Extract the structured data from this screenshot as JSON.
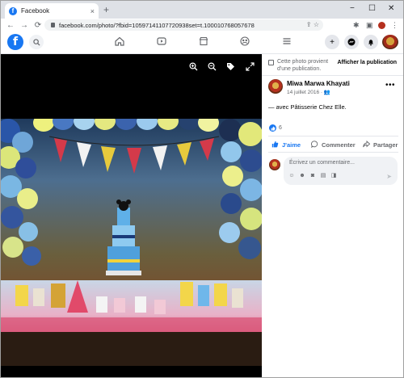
{
  "browser": {
    "tab_title": "Facebook",
    "tab_favicon": "f",
    "close_tab": "×",
    "new_tab": "+",
    "minimize": "−",
    "maximize": "☐",
    "close_window": "✕",
    "url": "facebook.com/photo/?fbid=10597141107720938set=t.100010768057678",
    "back": "←",
    "forward": "→",
    "reload": "⟳"
  },
  "facebook": {
    "logo": "f"
  },
  "panel": {
    "notice_text": "Cette photo provient d'une publication.",
    "notice_link": "Afficher la publication",
    "author": "Miwa Marwa Khayati",
    "date": "14 juillet 2016 · ",
    "caption": "— avec Pâtisserie Chez Elle.",
    "reaction_count": "6",
    "like_label": "J'aime",
    "comment_label": "Commenter",
    "share_label": "Partager",
    "comment_placeholder": "Écrivez un commentaire..."
  },
  "colors": {
    "brand": "#1877f2",
    "viewer_bg": "#000000"
  }
}
